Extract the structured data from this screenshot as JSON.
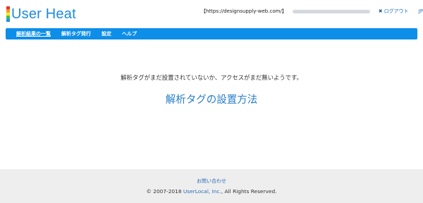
{
  "brand": {
    "name": "User Heat",
    "bar_colors": [
      "#e8322c",
      "#f49b1a",
      "#f6e71e",
      "#3cbf45",
      "#1f8fe0"
    ]
  },
  "account": {
    "site_url": "【https://designsupply-web.com/】",
    "logout_label": "ログアウト",
    "logout_icon": "close-icon",
    "language": "JP"
  },
  "nav": {
    "items": [
      {
        "label": "解析結果の一覧"
      },
      {
        "label": "解析タグ発行"
      },
      {
        "label": "設定"
      },
      {
        "label": "ヘルプ"
      }
    ]
  },
  "main": {
    "notice": "解析タグがまだ設置されていないか、アクセスがまだ無いようです。",
    "setup_link": "解析タグの設置方法"
  },
  "footer": {
    "contact": "お問い合わせ",
    "copyright_prefix": "© 2007-2018 ",
    "company": "UserLocal, Inc.",
    "copyright_suffix": ", All Rights Reserved."
  },
  "colors": {
    "accent": "#0d8ee9",
    "link": "#2a7fc8",
    "footer_bg": "#eeeeee"
  }
}
